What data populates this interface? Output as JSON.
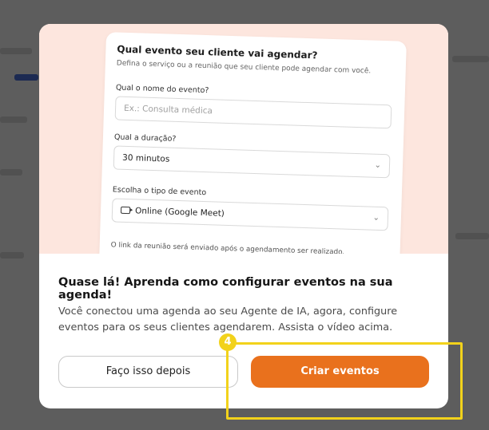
{
  "preview_form": {
    "title": "Qual evento seu cliente vai agendar?",
    "subtitle": "Defina o serviço ou a reunião que seu cliente pode agendar com você.",
    "name_label": "Qual o nome do evento?",
    "name_placeholder": "Ex.: Consulta médica",
    "duration_label": "Qual a duração?",
    "duration_value": "30 minutos",
    "type_label": "Escolha o tipo de evento",
    "type_value": "Online (Google Meet)",
    "note": "O link da reunião será enviado após o agendamento ser realizado."
  },
  "modal": {
    "heading": "Quase lá! Aprenda como configurar eventos na sua agenda!",
    "description": "Você conectou uma agenda ao seu Agente de IA, agora, configure eventos para os seus clientes agendarem. Assista o vídeo acima.",
    "secondary_button": "Faço isso depois",
    "primary_button": "Criar eventos"
  },
  "highlight": {
    "step_number": "4",
    "color": "#f2d21b"
  },
  "colors": {
    "accent": "#e9711d",
    "hero_background": "#fde6de"
  }
}
